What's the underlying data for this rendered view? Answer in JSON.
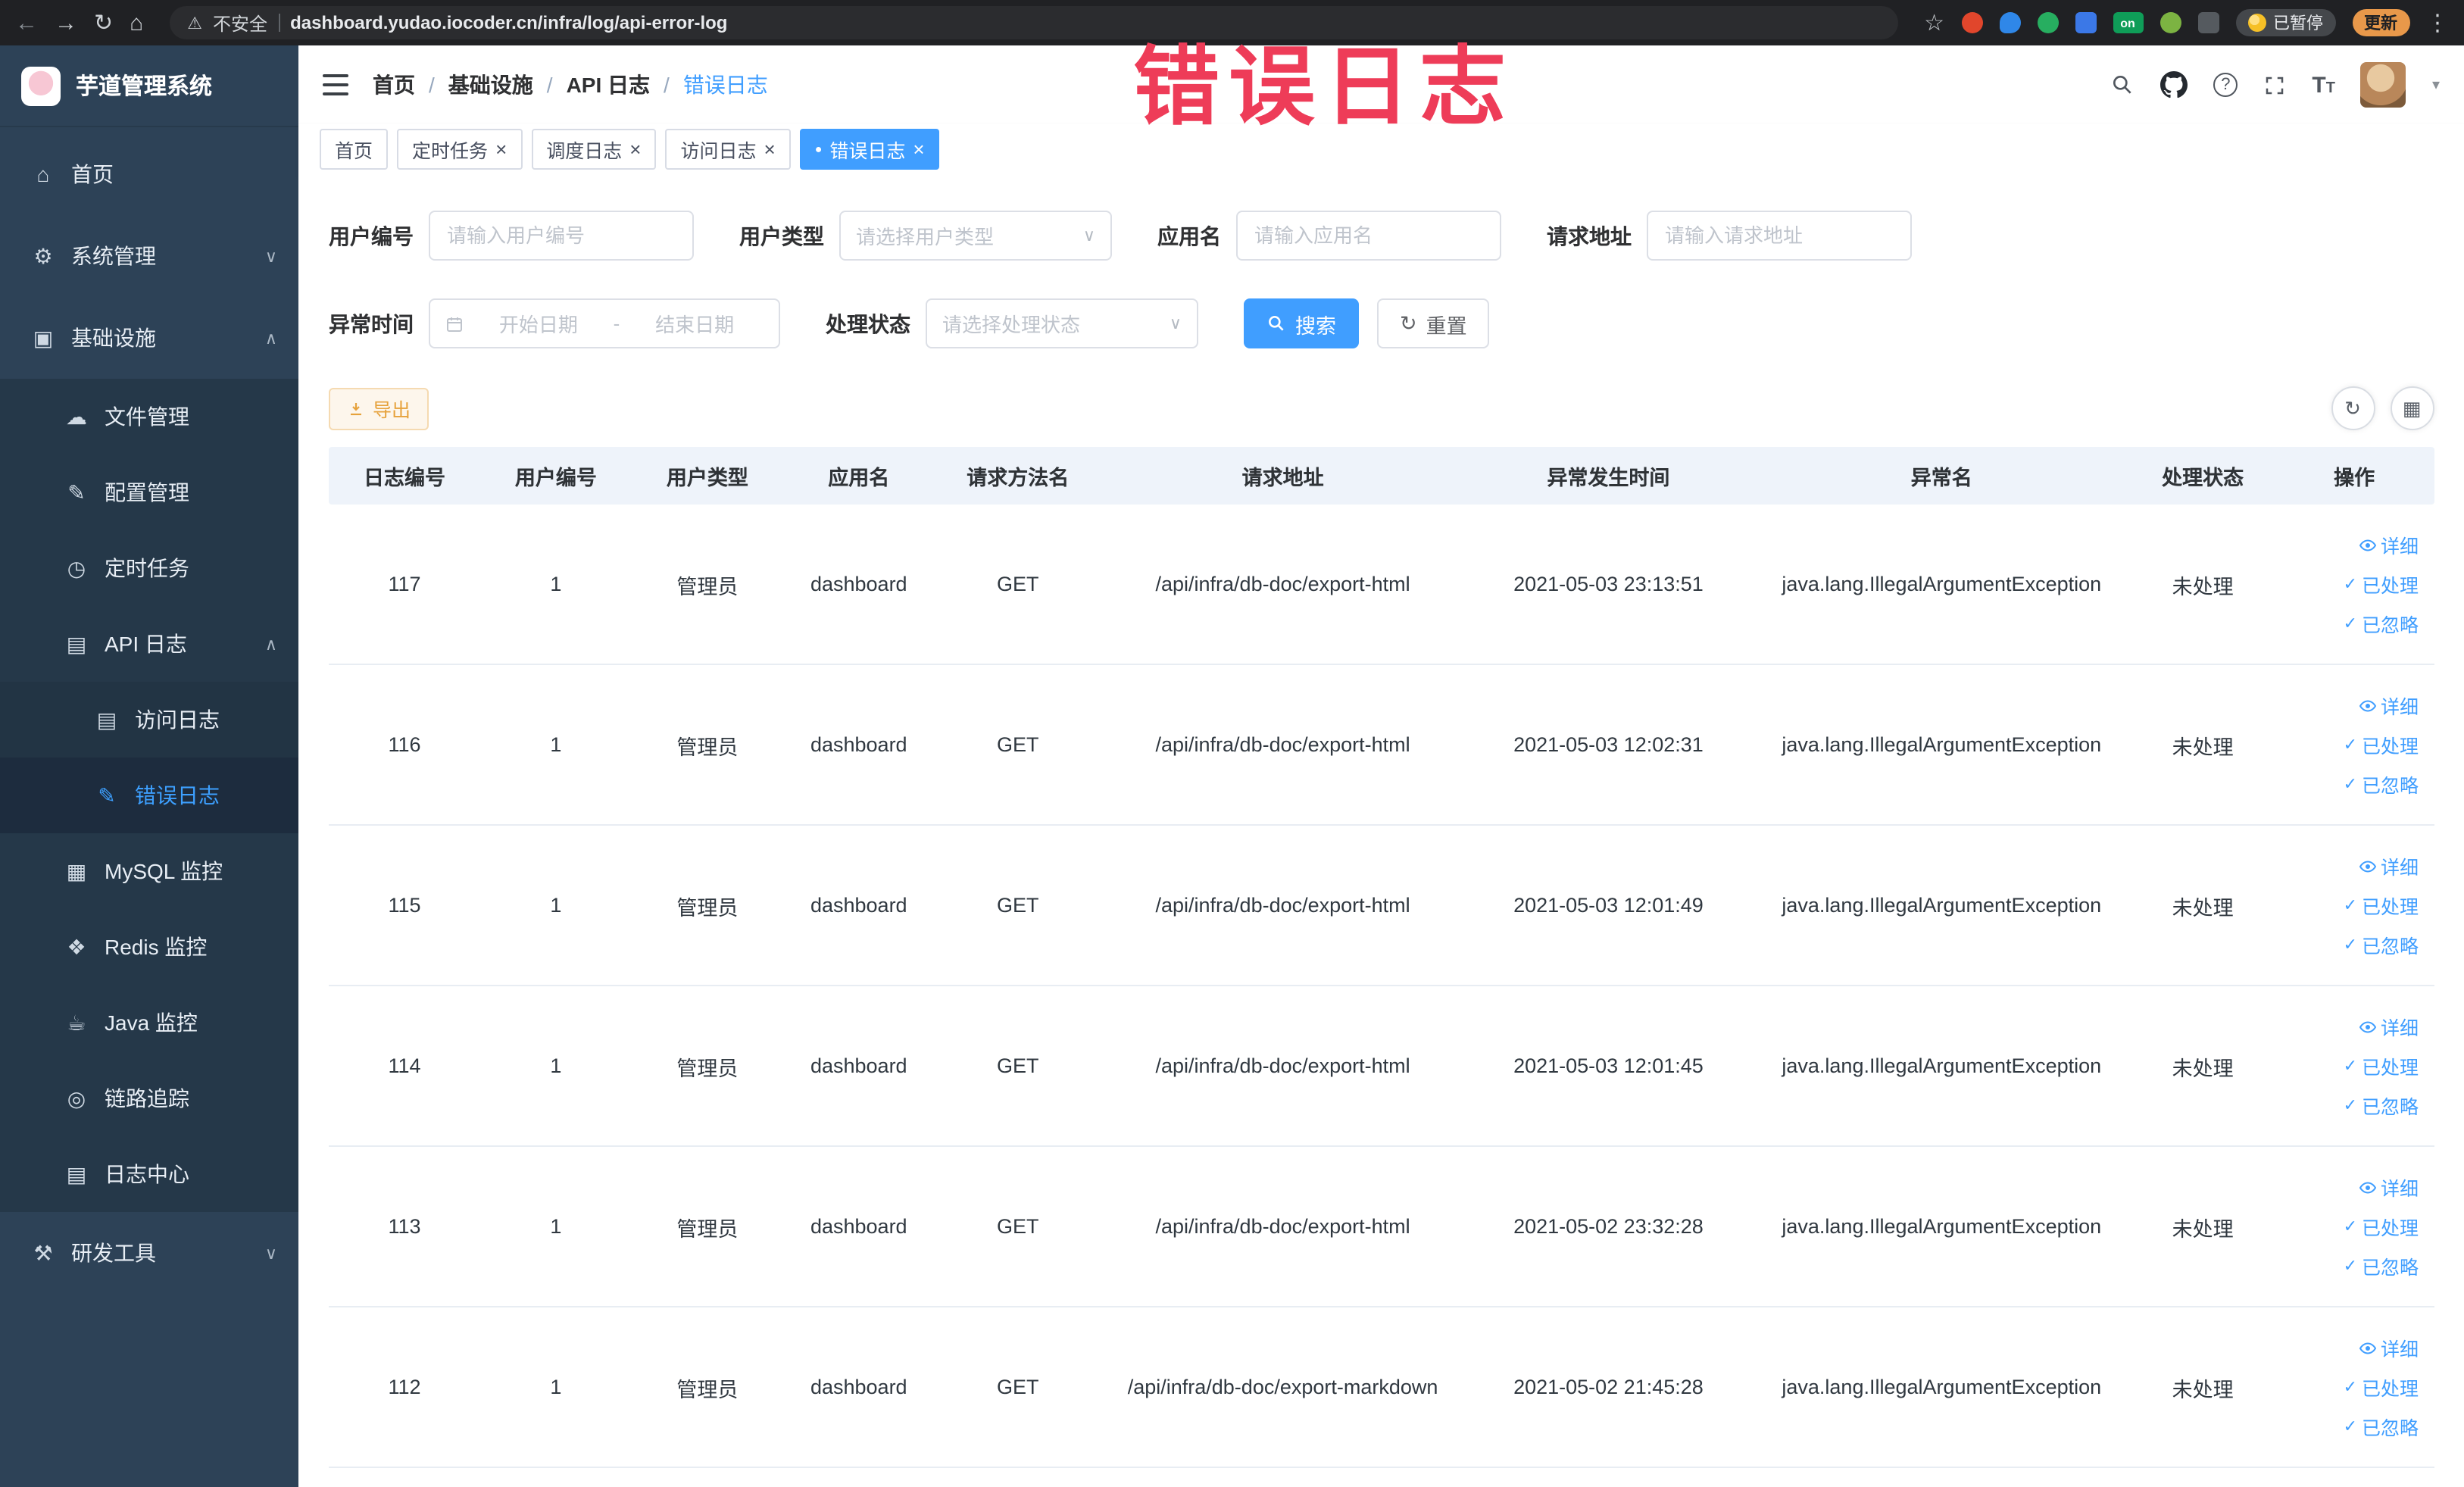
{
  "watermark": "错误日志",
  "colors": {
    "accent": "#409eff",
    "warning": "#e6a23c",
    "watermark_red": "#ee3c58",
    "sidebar_bg": "#2d4257",
    "submenu_bg": "#253849",
    "table_header_bg": "#eef3fa"
  },
  "icons": {
    "back": "←",
    "forward": "→",
    "reload": "↻",
    "home": "⌂",
    "warning": "⚠",
    "star": "☆",
    "more": "⋮",
    "question": "?",
    "chevron_down": "∨",
    "chevron_up": "∧",
    "caret_down": "▾",
    "check": "✓",
    "close": "×",
    "dot": "●",
    "refresh": "↻",
    "columns": "▦",
    "range_separator": "-",
    "font_size_large": "T",
    "font_size_small": "T",
    "on_badge": "on",
    "menu_home": "⌂",
    "menu_system": "⚙",
    "menu_infra": "▣",
    "menu_file": "☁",
    "menu_config": "✎",
    "menu_job": "◷",
    "menu_api_log": "▤",
    "menu_access_log": "▤",
    "menu_error_log": "✎",
    "menu_mysql": "▦",
    "menu_redis": "❖",
    "menu_java": "☕",
    "menu_trace": "◎",
    "menu_log_center": "▤",
    "menu_tools": "⚒"
  },
  "browser": {
    "security_label": "不安全",
    "url": "dashboard.yudao.iocoder.cn/infra/log/api-error-log",
    "paused_badge": "已暂停",
    "update_button": "更新"
  },
  "sidebar": {
    "title": "芋道管理系统",
    "items": [
      {
        "label": "首页"
      },
      {
        "label": "系统管理"
      },
      {
        "label": "基础设施"
      },
      {
        "label": "文件管理"
      },
      {
        "label": "配置管理"
      },
      {
        "label": "定时任务"
      },
      {
        "label": "API 日志"
      },
      {
        "label": "访问日志"
      },
      {
        "label": "错误日志"
      },
      {
        "label": "MySQL 监控"
      },
      {
        "label": "Redis 监控"
      },
      {
        "label": "Java 监控"
      },
      {
        "label": "链路追踪"
      },
      {
        "label": "日志中心"
      },
      {
        "label": "研发工具"
      }
    ]
  },
  "breadcrumb": {
    "items": [
      "首页",
      "基础设施",
      "API 日志",
      "错误日志"
    ],
    "separator": "/"
  },
  "tabs": [
    {
      "label": "首页"
    },
    {
      "label": "定时任务"
    },
    {
      "label": "调度日志"
    },
    {
      "label": "访问日志"
    },
    {
      "label": "错误日志"
    }
  ],
  "filters": {
    "user_id_label": "用户编号",
    "user_id_placeholder": "请输入用户编号",
    "user_type_label": "用户类型",
    "user_type_placeholder": "请选择用户类型",
    "app_name_label": "应用名",
    "app_name_placeholder": "请输入应用名",
    "request_url_label": "请求地址",
    "request_url_placeholder": "请输入请求地址",
    "time_label": "异常时间",
    "time_start_placeholder": "开始日期",
    "time_end_placeholder": "结束日期",
    "status_label": "处理状态",
    "status_placeholder": "请选择处理状态",
    "search_button": "搜索",
    "reset_button": "重置"
  },
  "toolbar": {
    "export_button": "导出"
  },
  "table": {
    "columns": [
      "日志编号",
      "用户编号",
      "用户类型",
      "应用名",
      "请求方法名",
      "请求地址",
      "异常发生时间",
      "异常名",
      "处理状态",
      "操作"
    ],
    "actions": {
      "detail": "详细",
      "processed": "已处理",
      "ignore": "已忽略"
    },
    "rows": [
      {
        "id": "117",
        "user_id": "1",
        "user_type": "管理员",
        "app": "dashboard",
        "method": "GET",
        "url": "/api/infra/db-doc/export-html",
        "time": "2021-05-03 23:13:51",
        "exception": "java.lang.IllegalArgumentException",
        "status": "未处理"
      },
      {
        "id": "116",
        "user_id": "1",
        "user_type": "管理员",
        "app": "dashboard",
        "method": "GET",
        "url": "/api/infra/db-doc/export-html",
        "time": "2021-05-03 12:02:31",
        "exception": "java.lang.IllegalArgumentException",
        "status": "未处理"
      },
      {
        "id": "115",
        "user_id": "1",
        "user_type": "管理员",
        "app": "dashboard",
        "method": "GET",
        "url": "/api/infra/db-doc/export-html",
        "time": "2021-05-03 12:01:49",
        "exception": "java.lang.IllegalArgumentException",
        "status": "未处理"
      },
      {
        "id": "114",
        "user_id": "1",
        "user_type": "管理员",
        "app": "dashboard",
        "method": "GET",
        "url": "/api/infra/db-doc/export-html",
        "time": "2021-05-03 12:01:45",
        "exception": "java.lang.IllegalArgumentException",
        "status": "未处理"
      },
      {
        "id": "113",
        "user_id": "1",
        "user_type": "管理员",
        "app": "dashboard",
        "method": "GET",
        "url": "/api/infra/db-doc/export-html",
        "time": "2021-05-02 23:32:28",
        "exception": "java.lang.IllegalArgumentException",
        "status": "未处理"
      },
      {
        "id": "112",
        "user_id": "1",
        "user_type": "管理员",
        "app": "dashboard",
        "method": "GET",
        "url": "/api/infra/db-doc/export-markdown",
        "time": "2021-05-02 21:45:28",
        "exception": "java.lang.IllegalArgumentException",
        "status": "未处理"
      }
    ]
  }
}
